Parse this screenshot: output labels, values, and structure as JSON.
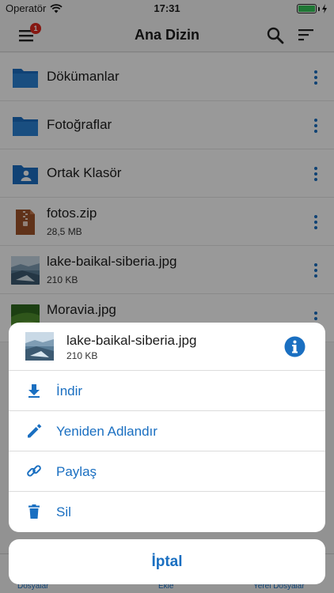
{
  "status_bar": {
    "carrier": "Operatör",
    "time": "17:31"
  },
  "nav": {
    "title": "Ana Dizin",
    "menu_badge": "1",
    "menu_icon": "hamburger-icon",
    "search_icon": "search-icon",
    "sort_icon": "sort-icon"
  },
  "files": [
    {
      "name": "Dökümanlar",
      "size": "",
      "icon": "folder-icon"
    },
    {
      "name": "Fotoğraflar",
      "size": "",
      "icon": "folder-icon"
    },
    {
      "name": "Ortak Klasör",
      "size": "",
      "icon": "shared-folder-icon"
    },
    {
      "name": "fotos.zip",
      "size": "28,5 MB",
      "icon": "zip-file-icon"
    },
    {
      "name": "lake-baikal-siberia.jpg",
      "size": "210 KB",
      "icon": "image-thumbnail"
    },
    {
      "name": "Moravia.jpg",
      "size": "",
      "icon": "image-thumbnail"
    }
  ],
  "sheet": {
    "file_name": "lake-baikal-siberia.jpg",
    "file_size": "210 KB",
    "actions": [
      {
        "label": "İndir",
        "icon": "download-icon"
      },
      {
        "label": "Yeniden Adlandır",
        "icon": "pencil-icon"
      },
      {
        "label": "Paylaş",
        "icon": "link-icon"
      },
      {
        "label": "Sil",
        "icon": "trash-icon"
      }
    ],
    "cancel_label": "İptal"
  },
  "tabbar": {
    "files_label": "Dosyalar",
    "add_label": "Ekle",
    "local_label": "Yerel Dosyalar"
  },
  "colors": {
    "accent": "#1a6fc1",
    "folder": "#1b6fc3",
    "badge": "#e0271d",
    "zip": "#a0542b",
    "battery": "#35c759"
  }
}
